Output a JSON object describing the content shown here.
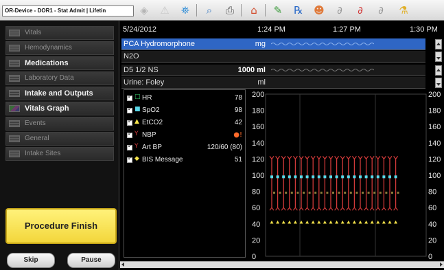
{
  "window": {
    "title": "OR-Device - DOR1 - Stat Admit | Lifetin"
  },
  "toolbar": {
    "icons": [
      "diamond-icon",
      "warning-icon",
      "network-icon",
      "search-icon",
      "print-icon",
      "home-icon",
      "pen-icon",
      "pills-icon",
      "tongue-icon",
      "lungs-icon",
      "lungs-red-icon",
      "lungs-drip-icon",
      "flask-icon"
    ]
  },
  "sidebar": {
    "items": [
      {
        "label": "Vitals",
        "bold": false
      },
      {
        "label": "Hemodynamics",
        "bold": false
      },
      {
        "label": "Medications",
        "bold": true
      },
      {
        "label": "Laboratory Data",
        "bold": false
      },
      {
        "label": "Intake and Outputs",
        "bold": true
      },
      {
        "label": "Vitals Graph",
        "bold": true
      },
      {
        "label": "Events",
        "bold": false
      },
      {
        "label": "General",
        "bold": false
      },
      {
        "label": "Intake Sites",
        "bold": false
      }
    ],
    "finish_label": "Procedure Finish",
    "skip_label": "Skip",
    "pause_label": "Pause"
  },
  "main": {
    "date": "5/24/2012",
    "times": [
      "1:24 PM",
      "1:27 PM",
      "1:30 PM"
    ],
    "med_rows": [
      {
        "label": "PCA Hydromorphone",
        "unit": "mg",
        "selected": true
      },
      {
        "label": "N2O",
        "unit": "",
        "selected": false
      }
    ],
    "io_rows": [
      {
        "label": "D5 1/2 NS",
        "unit": "1000 ml"
      },
      {
        "label": "Urine: Foley",
        "unit": "ml"
      }
    ],
    "legend": [
      {
        "name": "HR",
        "symbol": "□",
        "color": "#35c96a",
        "value": "78"
      },
      {
        "name": "SpO2",
        "symbol": "■",
        "color": "#5ad8e8",
        "value": "98"
      },
      {
        "name": "EtCO2",
        "symbol": "▲",
        "color": "#f3e24a",
        "value": "42"
      },
      {
        "name": "NBP",
        "symbol": "Y",
        "color": "#d23a3a",
        "value": "●!"
      },
      {
        "name": "Art BP",
        "symbol": "Y",
        "color": "#d23a3a",
        "value": "120/60 (80)"
      },
      {
        "name": "BIS Message",
        "symbol": "◆",
        "color": "#f3e24a",
        "value": "51"
      }
    ],
    "y_ticks": [
      "200",
      "180",
      "160",
      "140",
      "120",
      "100",
      "80",
      "60",
      "40",
      "20",
      "0"
    ]
  },
  "chart_data": {
    "type": "scatter",
    "ylim": [
      0,
      200
    ],
    "y_ticks": [
      200,
      180,
      160,
      140,
      120,
      100,
      80,
      60,
      40,
      20,
      0
    ],
    "series": [
      {
        "name": "SpO2",
        "color": "#5ad8e8",
        "values": [
          98,
          98,
          98,
          98,
          98,
          98,
          98,
          98,
          98,
          98,
          98,
          98,
          98,
          98,
          98,
          98,
          98,
          98,
          98,
          98,
          98,
          98
        ]
      },
      {
        "name": "EtCO2",
        "color": "#f3e24a",
        "values": [
          42,
          42,
          42,
          42,
          42,
          42,
          42,
          42,
          42,
          42,
          42,
          42,
          42,
          42,
          42,
          42,
          42,
          42,
          42,
          42,
          42,
          42
        ]
      },
      {
        "name": "Art BP",
        "color": "#d23a3a",
        "systolic": [
          120,
          120,
          120,
          120,
          120,
          120,
          120,
          120,
          120,
          120,
          120,
          120,
          120,
          120,
          120,
          120,
          120,
          120,
          120,
          120,
          120,
          120
        ],
        "diastolic": [
          60,
          60,
          60,
          60,
          60,
          60,
          60,
          60,
          60,
          60,
          60,
          60,
          60,
          60,
          60,
          60,
          60,
          60,
          60,
          60,
          60,
          60
        ]
      },
      {
        "name": "HR",
        "color": "#8a7a3a",
        "values": [
          78,
          78,
          78,
          78,
          78,
          78,
          78,
          78,
          78,
          78,
          78,
          78,
          78,
          78,
          78,
          78,
          78,
          78,
          78,
          78,
          78,
          78
        ]
      }
    ]
  }
}
